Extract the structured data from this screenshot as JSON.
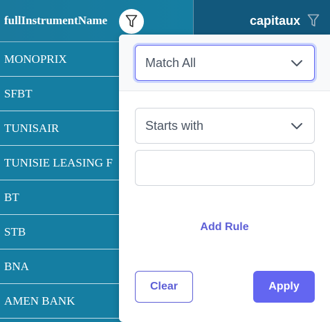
{
  "table": {
    "columns": [
      {
        "label": "fullInstrumentName",
        "filter_icon": "filter-icon"
      },
      {
        "label": "capitaux",
        "filter_icon": "filter-icon"
      }
    ],
    "rows": [
      "MONOPRIX",
      "SFBT",
      "TUNISAIR",
      "TUNISIE LEASING F",
      "BT",
      "STB",
      "BNA",
      "AMEN BANK"
    ]
  },
  "filter_panel": {
    "operator": "Match All",
    "rule": {
      "match_mode": "Starts with",
      "value": "",
      "placeholder": ""
    },
    "add_rule_label": "Add Rule",
    "clear_label": "Clear",
    "apply_label": "Apply"
  },
  "colors": {
    "header_bg": "#157ea2",
    "accent": "#6366f1"
  }
}
